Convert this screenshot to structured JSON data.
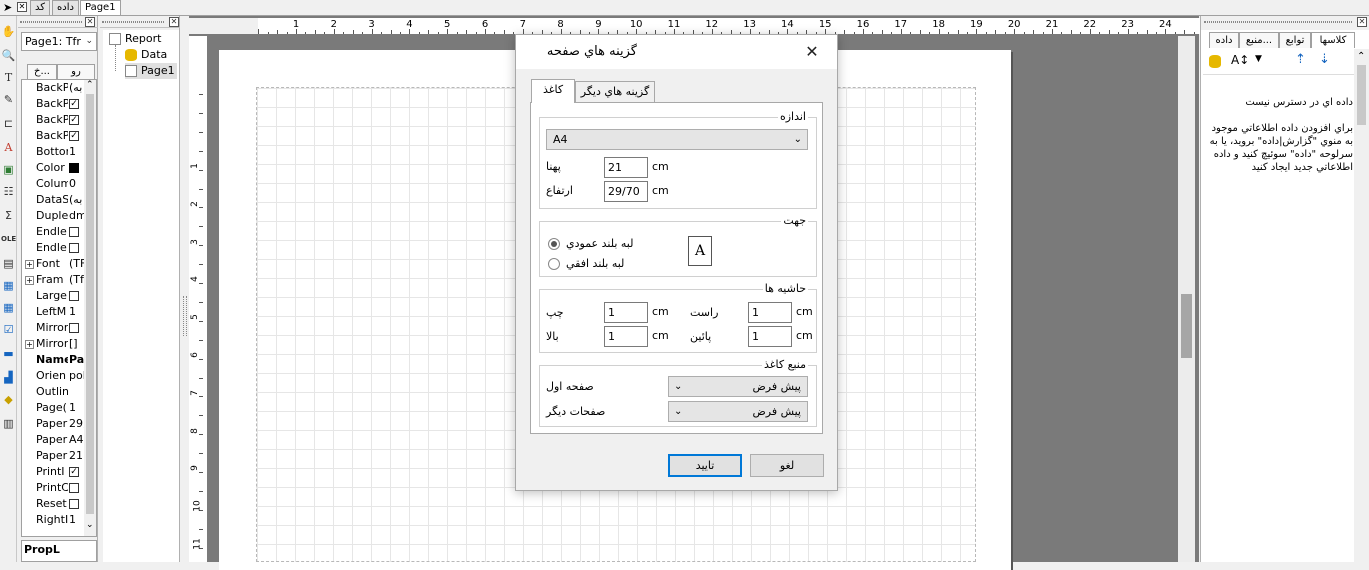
{
  "top_tabs": [
    "کد",
    "داده",
    "Page1"
  ],
  "props": {
    "page_select": "Page1: Tfr",
    "tabs": [
      "رو",
      "خ..."
    ],
    "rows": [
      {
        "name": "BackP",
        "value": "(به",
        "kind": "text"
      },
      {
        "name": "BackP",
        "value": "✓",
        "kind": "check"
      },
      {
        "name": "BackP",
        "value": "✓",
        "kind": "check"
      },
      {
        "name": "BackP",
        "value": "✓",
        "kind": "check"
      },
      {
        "name": "Bottor",
        "value": "1",
        "kind": "text"
      },
      {
        "name": "Color",
        "value": "",
        "kind": "swatch"
      },
      {
        "name": "Colum",
        "value": "0",
        "kind": "text"
      },
      {
        "name": "DataS",
        "value": "(به",
        "kind": "text"
      },
      {
        "name": "Duple",
        "value": "dm",
        "kind": "text"
      },
      {
        "name": "Endle:",
        "value": "",
        "kind": "check"
      },
      {
        "name": "Endle:",
        "value": "",
        "kind": "check"
      },
      {
        "name": "Font",
        "value": "(TF",
        "kind": "plus"
      },
      {
        "name": "Fram",
        "value": "(Tf",
        "kind": "plus"
      },
      {
        "name": "Large",
        "value": "",
        "kind": "check"
      },
      {
        "name": "LeftM",
        "value": "1",
        "kind": "text"
      },
      {
        "name": "Mirror",
        "value": "",
        "kind": "check"
      },
      {
        "name": "Mirror",
        "value": "[]",
        "kind": "plus"
      },
      {
        "name": "Name",
        "value": "Pa",
        "kind": "bold"
      },
      {
        "name": "Orien",
        "value": "pol",
        "kind": "text"
      },
      {
        "name": "Outlin",
        "value": "",
        "kind": "text"
      },
      {
        "name": "Page(",
        "value": "1",
        "kind": "text"
      },
      {
        "name": "Paper",
        "value": "29,",
        "kind": "text"
      },
      {
        "name": "Paper",
        "value": "A4",
        "kind": "text"
      },
      {
        "name": "Paper",
        "value": "21",
        "kind": "text"
      },
      {
        "name": "PrintI",
        "value": "✓",
        "kind": "check"
      },
      {
        "name": "PrintC",
        "value": "",
        "kind": "check"
      },
      {
        "name": "Reset",
        "value": "",
        "kind": "check"
      },
      {
        "name": "RightI",
        "value": "1",
        "kind": "text"
      }
    ],
    "footer": "PropL"
  },
  "tree": {
    "root": "Report",
    "data": "Data",
    "page": "Page1"
  },
  "ruler": {
    "h": [
      "1",
      "2",
      "3",
      "4",
      "5",
      "6",
      "7",
      "8",
      "9",
      "10",
      "11",
      "12",
      "13",
      "14",
      "15",
      "16",
      "17",
      "18",
      "19",
      "20",
      "21",
      "22",
      "23",
      "24"
    ],
    "v": [
      "1",
      "2",
      "3",
      "4",
      "5",
      "6",
      "7",
      "8",
      "9",
      "10",
      "11",
      "12"
    ]
  },
  "right": {
    "tabs": [
      "کلاسها",
      "توابع",
      "منبع...",
      "داده"
    ],
    "msg_title": "داده اي در دسترس نيست",
    "msg_body": "براي افزودن داده اطلاعاتي موجود به منوي \"گزارش|داده\" برويد، يا به سرلوحه \"داده\" سوئيچ كنيد و داده اطلاعاتي جديد ايجاد كنيد"
  },
  "dialog": {
    "title": "گزينه هاي صفحه",
    "tab_paper": "كاغذ",
    "tab_other": "گزينه هاي ديگر",
    "size_label": "اندازه",
    "size_value": "A4",
    "width_label": "پهنا",
    "width_value": "21",
    "height_label": "ارتفاع",
    "height_value": "29/70",
    "unit": "cm",
    "orient_label": "جهت",
    "portrait": "لبه بلند عمودي",
    "landscape": "لبه بلند افقي",
    "orient_icon_letter": "A",
    "margins_label": "حاشيه ها",
    "left_label": "چپ",
    "left_value": "1",
    "right_label": "راست",
    "right_value": "1",
    "top_label": "بالا",
    "top_value": "1",
    "bottom_label": "پائين",
    "bottom_value": "1",
    "source_label": "منبع كاغذ",
    "first_page_label": "صفحه اول",
    "first_page_value": "پيش فرض",
    "other_pages_label": "صفحات ديگر",
    "other_pages_value": "پيش فرض",
    "ok": "تاييد",
    "cancel": "لغو"
  }
}
